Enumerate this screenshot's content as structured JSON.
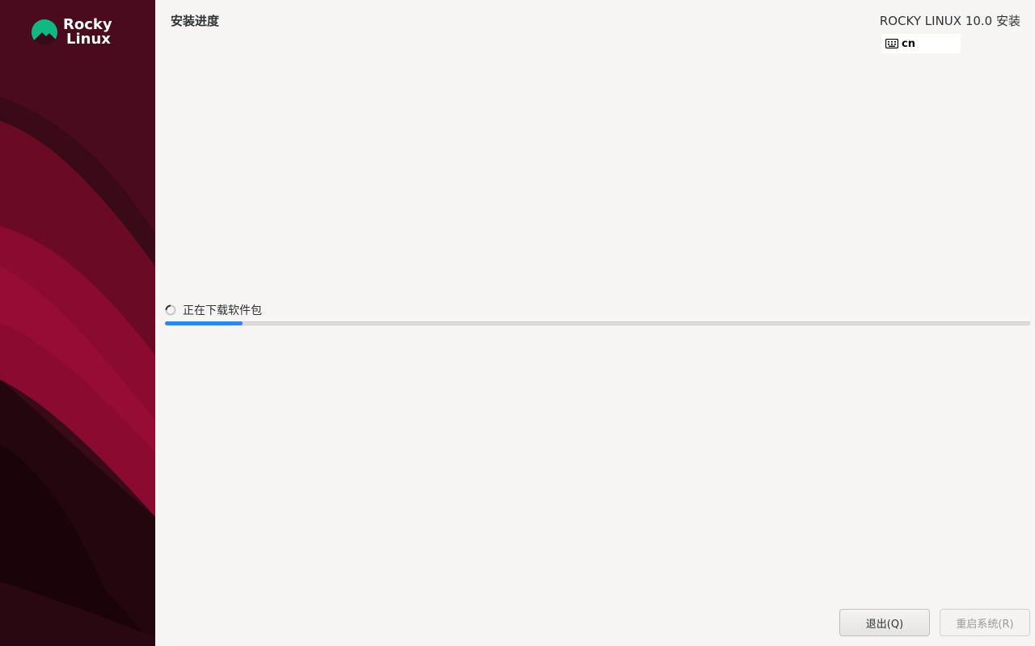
{
  "sidebar": {
    "logo_line1": "Rocky",
    "logo_line2": "Linux",
    "logo_icon": "rocky-mountain-logo",
    "accent_color": "#10b981"
  },
  "header": {
    "page_title": "安装进度",
    "product_title": "ROCKY LINUX 10.0 安装",
    "keyboard_layout": "cn",
    "keyboard_icon": "keyboard-icon"
  },
  "progress": {
    "status_text": "正在下载软件包",
    "fraction": 0.09,
    "spinner_icon": "spinner-icon"
  },
  "buttons": {
    "quit_label": "退出(Q)",
    "reboot_label": "重启系统(R)"
  }
}
